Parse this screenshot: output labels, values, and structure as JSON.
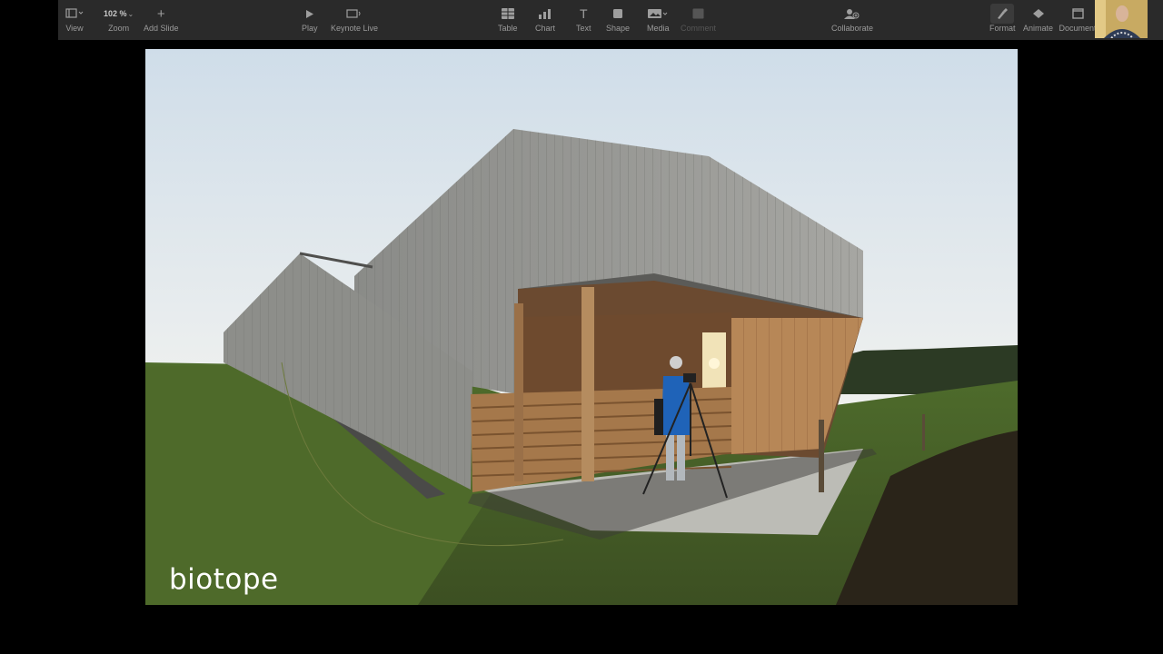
{
  "toolbar": {
    "items": [
      {
        "label": "View",
        "icon": "view-icon"
      },
      {
        "label": "Zoom",
        "value": "102 %",
        "icon": "chevron-down-icon"
      },
      {
        "label": "Add Slide",
        "icon": "plus-icon"
      },
      {
        "label": "Play",
        "icon": "play-icon"
      },
      {
        "label": "Keynote Live",
        "icon": "keynote-live-icon"
      },
      {
        "label": "Table",
        "icon": "table-icon"
      },
      {
        "label": "Chart",
        "icon": "chart-icon"
      },
      {
        "label": "Text",
        "icon": "text-icon"
      },
      {
        "label": "Shape",
        "icon": "shape-icon"
      },
      {
        "label": "Media",
        "icon": "media-icon"
      },
      {
        "label": "Comment",
        "icon": "comment-icon"
      },
      {
        "label": "Collaborate",
        "icon": "collaborate-icon"
      },
      {
        "label": "Format",
        "icon": "format-icon"
      },
      {
        "label": "Animate",
        "icon": "animate-icon"
      },
      {
        "label": "Document",
        "icon": "document-icon"
      }
    ]
  },
  "slide": {
    "caption": "biotope"
  },
  "colors": {
    "toolbar_bg": "#2a2a2a",
    "background": "#000000",
    "caption": "#ffffff"
  }
}
